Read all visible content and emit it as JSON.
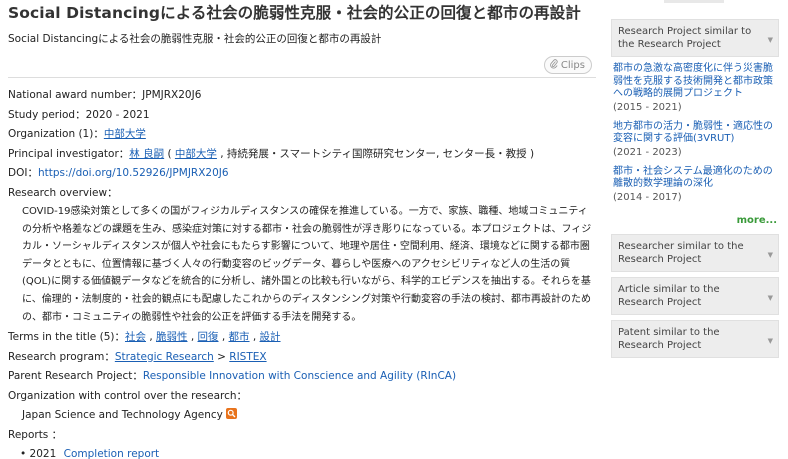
{
  "title": "Social Distancingによる社会の脆弱性克服・社会的公正の回復と都市の再設計",
  "subtitle": "Social Distancingによる社会の脆弱性克服・社会的公正の回復と都市の再設計",
  "clips_label": "Clips",
  "award": {
    "label": "National award number：",
    "value": "JPMJRX20J6"
  },
  "period": {
    "label": "Study period：",
    "value": "2020 - 2021"
  },
  "organization": {
    "label": "Organization (1)：",
    "link": "中部大学"
  },
  "pi": {
    "label": "Principal investigator：",
    "name": "林 良嗣",
    "open": " ( ",
    "org_link": "中部大学",
    "rest": " , 持続発展・スマートシティ国際研究センター, センター長・教授 )"
  },
  "doi": {
    "label": "DOI：",
    "value": "https://doi.org/10.52926/JPMJRX20J6"
  },
  "overview": {
    "label": "Research overview：",
    "text": "COVID-19感染対策として多くの国がフィジカルディスタンスの確保を推進している。一方で、家族、職種、地域コミュニティの分析や格差などの課題を生み、感染症対策に対する都市・社会の脆弱性が浮き彫りになっている。本プロジェクトは、フィジカル・ソーシャルディスタンスが個人や社会にもたらす影響について、地理や居住・空間利用、経済、環境などに関する都市圏データとともに、位置情報に基づく人々の行動変容のビッグデータ、暮らしや医療へのアクセシビリティなど人の生活の質(QOL)に関する価値観データなどを統合的に分析し、諸外国との比較も行いながら、科学的エビデンスを抽出する。それらを基に、倫理的・法制度的・社会的観点にも配慮したこれからのディスタンシング対策や行動変容の手法の検討、都市再設計のための、都市・コミュニティの脆弱性や社会的公正を評価する手法を開発する。"
  },
  "terms": {
    "label": "Terms in the title (5)：",
    "items": [
      "社会",
      "脆弱性",
      "回復",
      "都市",
      "設計"
    ]
  },
  "program": {
    "label": "Research program：",
    "link1": "Strategic Research",
    "sep": " > ",
    "link2": "RISTEX"
  },
  "parent": {
    "label": "Parent Research Project：",
    "link": "Responsible Innovation with Conscience and Agility (RInCA)"
  },
  "control": {
    "label": "Organization with control over the research：",
    "value": "Japan Science and Technology Agency"
  },
  "reports": {
    "label": "Reports ：",
    "year": "2021",
    "link": "Completion report"
  },
  "sidebar": {
    "similar_projects_label": "Research Project similar to the Research Project",
    "projects": [
      {
        "title": "都市の急激な高密度化に伴う災害脆弱性を克服する技術開発と都市政策への戦略的展開プロジェクト",
        "years": "(2015 - 2021)"
      },
      {
        "title": "地方都市の活力・脆弱性・適応性の変容に関する評価(3VRUT)",
        "years": "(2021 - 2023)"
      },
      {
        "title": "都市・社会システム最適化のための離散的数学理論の深化",
        "years": "(2014 - 2017)"
      }
    ],
    "more": "more...",
    "researcher_label": "Researcher similar to the Research Project",
    "article_label": "Article similar to the Research Project",
    "patent_label": "Patent similar to the Research Project"
  }
}
